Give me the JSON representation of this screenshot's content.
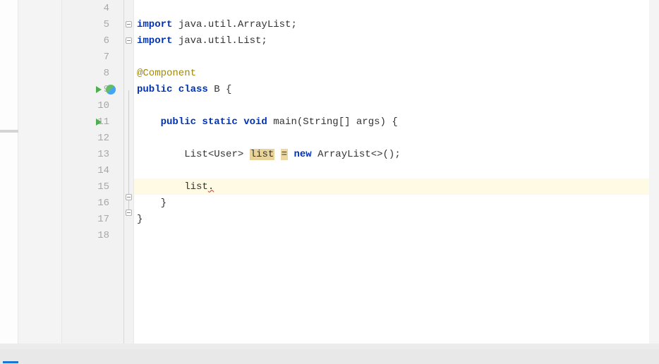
{
  "lines": {
    "4": {
      "num": "4",
      "tokens": []
    },
    "5": {
      "num": "5",
      "tokens": [
        {
          "t": "import ",
          "c": "kw"
        },
        {
          "t": "java.util.ArrayList;",
          "c": "cls"
        }
      ]
    },
    "6": {
      "num": "6",
      "tokens": [
        {
          "t": "import ",
          "c": "kw"
        },
        {
          "t": "java.util.List;",
          "c": "cls"
        }
      ]
    },
    "7": {
      "num": "7",
      "tokens": []
    },
    "8": {
      "num": "8",
      "tokens": [
        {
          "t": "@Component",
          "c": "annotation"
        }
      ]
    },
    "9": {
      "num": "9",
      "tokens": [
        {
          "t": "public class ",
          "c": "kw"
        },
        {
          "t": "B ",
          "c": "cls"
        },
        {
          "t": "{",
          "c": "paren"
        }
      ]
    },
    "10": {
      "num": "10",
      "tokens": []
    },
    "11": {
      "num": "11",
      "tokens": [
        {
          "t": "    ",
          "c": ""
        },
        {
          "t": "public static void ",
          "c": "kw"
        },
        {
          "t": "main",
          "c": "method"
        },
        {
          "t": "(",
          "c": "paren"
        },
        {
          "t": "String",
          "c": "cls"
        },
        {
          "t": "[] ",
          "c": "paren"
        },
        {
          "t": "args",
          "c": "cls"
        },
        {
          "t": ") {",
          "c": "paren"
        }
      ]
    },
    "12": {
      "num": "12",
      "tokens": []
    },
    "13": {
      "num": "13",
      "tokens": [
        {
          "t": "        ",
          "c": ""
        },
        {
          "t": "List",
          "c": "cls"
        },
        {
          "t": "<",
          "c": "paren"
        },
        {
          "t": "User",
          "c": "cls"
        },
        {
          "t": "> ",
          "c": "paren"
        },
        {
          "t": "list",
          "c": "hl-var"
        },
        {
          "t": " ",
          "c": ""
        },
        {
          "t": "=",
          "c": "hl-op"
        },
        {
          "t": " ",
          "c": ""
        },
        {
          "t": "new ",
          "c": "kw"
        },
        {
          "t": "ArrayList",
          "c": "cls"
        },
        {
          "t": "<>();",
          "c": "paren"
        }
      ]
    },
    "14": {
      "num": "14",
      "tokens": []
    },
    "15": {
      "num": "15",
      "tokens": [
        {
          "t": "        list",
          "c": "cls"
        },
        {
          "t": ".",
          "c": "err-underline"
        }
      ]
    },
    "16": {
      "num": "16",
      "tokens": [
        {
          "t": "    }",
          "c": "paren"
        }
      ]
    },
    "17": {
      "num": "17",
      "tokens": [
        {
          "t": "}",
          "c": "paren"
        }
      ]
    },
    "18": {
      "num": "18",
      "tokens": []
    }
  }
}
